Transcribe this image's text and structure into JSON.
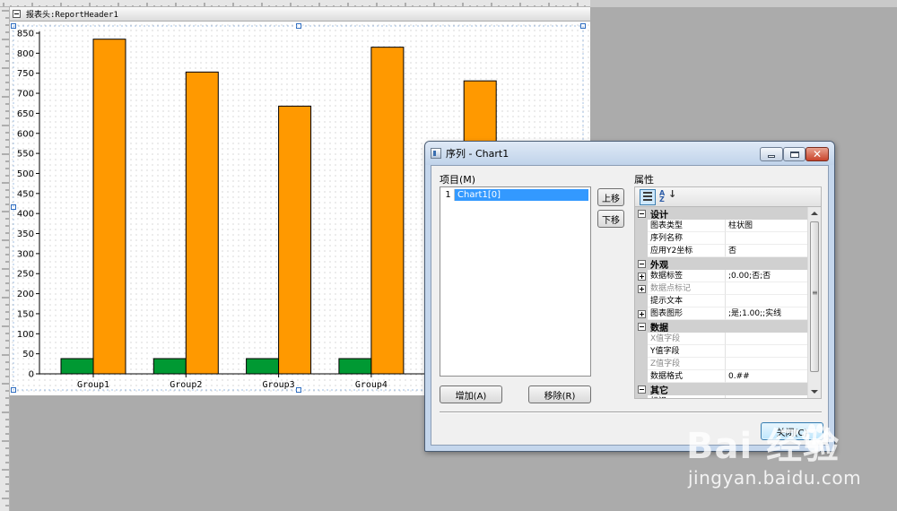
{
  "colors": {
    "bar_orange": "#ff9900",
    "bar_green": "#009933",
    "selection_blue": "#3399ff",
    "canvas_gray": "#ababab"
  },
  "designer": {
    "band_title": "报表头:ReportHeader1"
  },
  "chart_data": {
    "type": "bar",
    "categories": [
      "Group1",
      "Group2",
      "Group3",
      "Group4",
      ""
    ],
    "series": [
      {
        "values": [
          38,
          38,
          38,
          38,
          38
        ],
        "color": "#009933"
      },
      {
        "values": [
          835,
          753,
          668,
          815,
          731
        ],
        "color": "#ff9900"
      }
    ],
    "ylim": [
      0,
      850
    ],
    "yticks": [
      0,
      50,
      100,
      150,
      200,
      250,
      300,
      350,
      400,
      450,
      500,
      550,
      600,
      650,
      700,
      750,
      800,
      850
    ],
    "grid": false
  },
  "dialog": {
    "title": "序列 - Chart1",
    "items_label": "项目(M)",
    "items": [
      {
        "index": "1",
        "label": "Chart1[0]"
      }
    ],
    "move_up": "上移",
    "move_down": "下移",
    "add": "增加(A)",
    "remove": "移除(R)",
    "close": "关闭(C)",
    "props_label": "属性",
    "sort_glyph_top": "A",
    "sort_glyph_bottom": "Z",
    "sort_arrow": "↓",
    "properties": [
      {
        "kind": "category",
        "name": "设计"
      },
      {
        "kind": "row",
        "name": "图表类型",
        "value": "柱状图"
      },
      {
        "kind": "row",
        "name": "序列名称",
        "value": ""
      },
      {
        "kind": "row",
        "name": "应用Y2坐标",
        "value": "否"
      },
      {
        "kind": "category",
        "name": "外观"
      },
      {
        "kind": "row",
        "name": "数据标签",
        "value": ";0.00;否;否",
        "expandable": true
      },
      {
        "kind": "row",
        "name": "数据点标记",
        "value": "",
        "expandable": true,
        "disabled": true
      },
      {
        "kind": "row",
        "name": "提示文本",
        "value": ""
      },
      {
        "kind": "row",
        "name": "图表图形",
        "value": ";是;1.00;;实线",
        "expandable": true
      },
      {
        "kind": "category",
        "name": "数据"
      },
      {
        "kind": "row",
        "name": "X值字段",
        "value": "",
        "disabled": true
      },
      {
        "kind": "row",
        "name": "Y值字段",
        "value": ""
      },
      {
        "kind": "row",
        "name": "Z值字段",
        "value": "",
        "disabled": true
      },
      {
        "kind": "row",
        "name": "数据格式",
        "value": "0.##"
      },
      {
        "kind": "category",
        "name": "其它"
      },
      {
        "kind": "row",
        "name": "标识",
        "value": ""
      }
    ]
  },
  "watermark": {
    "logo": "Bai  经验",
    "url": "jingyan.baidu.com"
  }
}
